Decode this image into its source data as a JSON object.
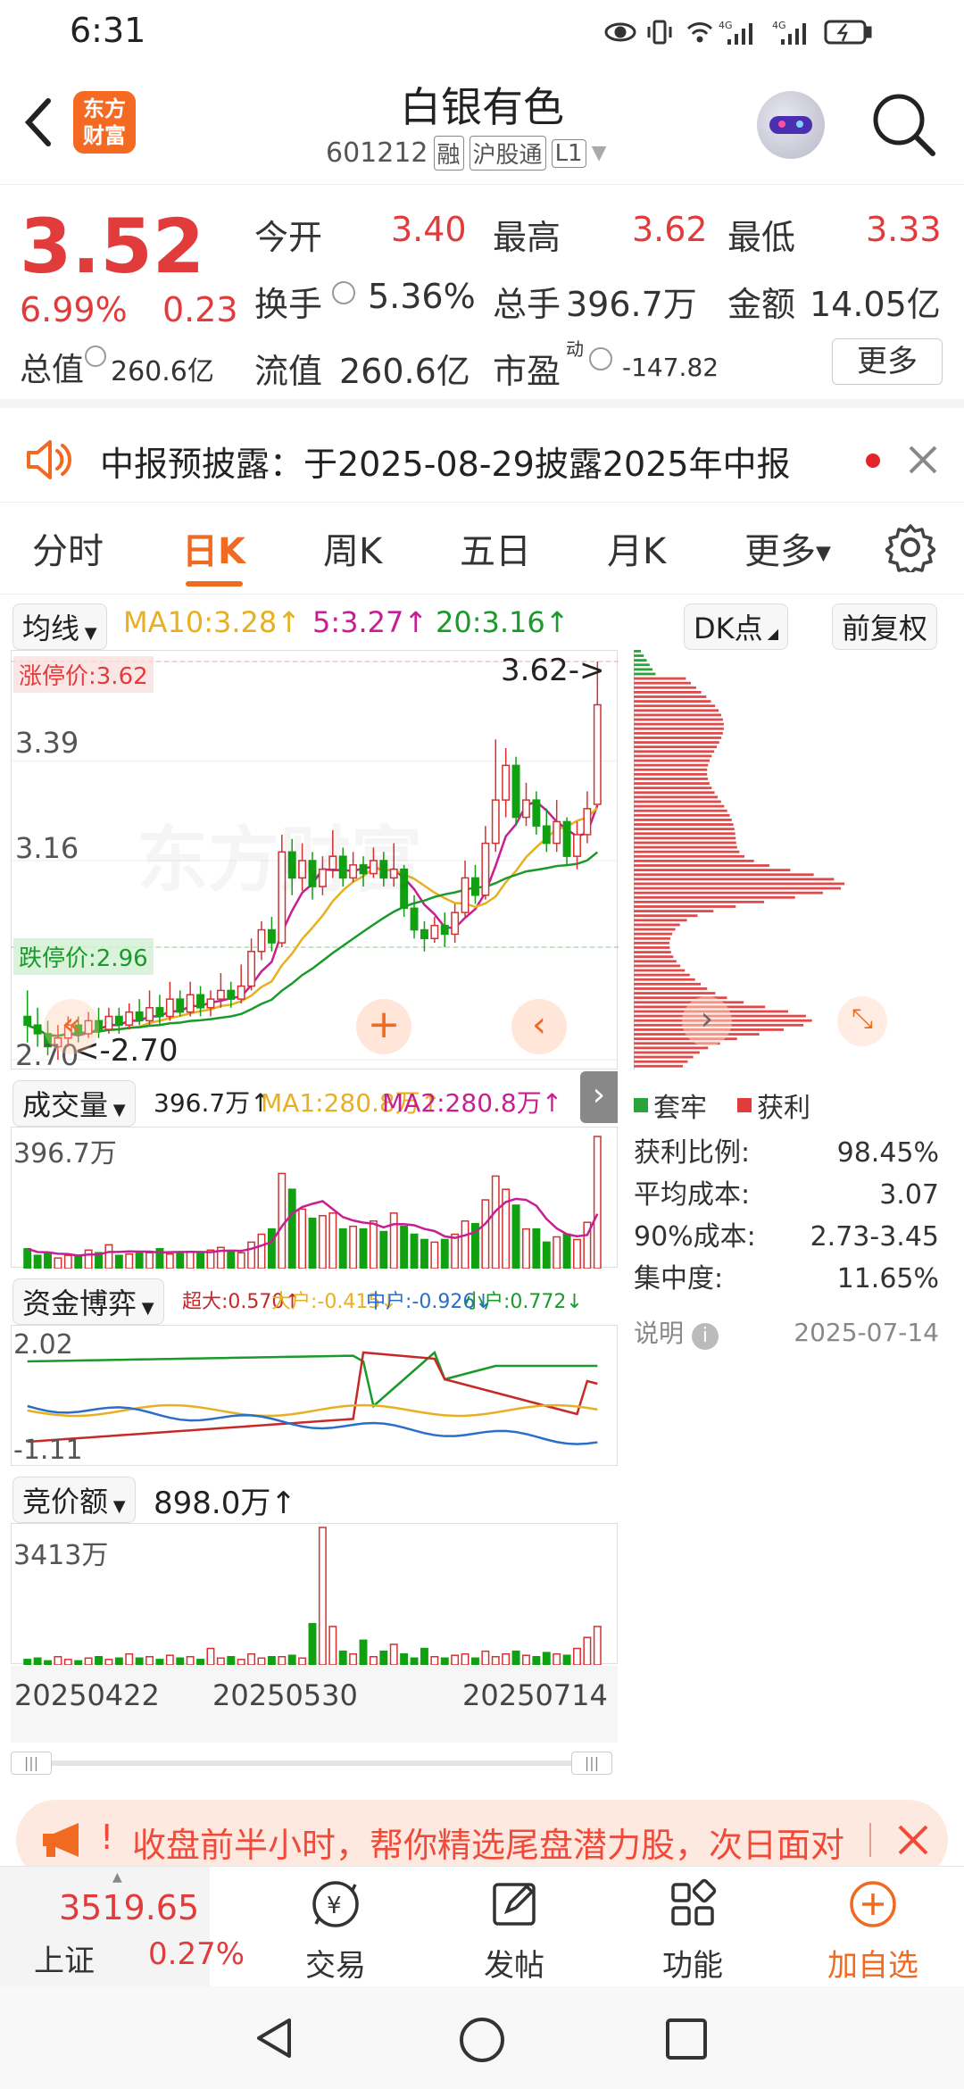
{
  "status": {
    "time": "6:31"
  },
  "header": {
    "title": "白银有色",
    "code": "601212",
    "tags": [
      "融",
      "沪股通",
      "L1"
    ],
    "logo_lines": [
      "东方",
      "财富"
    ]
  },
  "quote": {
    "price": "3.52",
    "change_pct": "6.99%",
    "change": "0.23",
    "rows": [
      [
        {
          "label": "今开",
          "value": "3.40"
        },
        {
          "label": "最高",
          "value": "3.62"
        },
        {
          "label": "最低",
          "value": "3.33"
        }
      ],
      [
        {
          "label": "换手",
          "value": "5.36%"
        },
        {
          "label": "总手",
          "value": "396.7万"
        },
        {
          "label": "金额",
          "value": "14.05亿"
        }
      ]
    ],
    "cap_label": "总值",
    "cap_value": "260.6亿",
    "float_label": "流值",
    "float_value": "260.6亿",
    "pe_label": "市盈",
    "pe_sup": "动",
    "pe_value": "-147.82",
    "more": "更多"
  },
  "notice": {
    "text": "中报预披露：于2025-08-29披露2025年中报"
  },
  "tabs": [
    "分时",
    "日K",
    "周K",
    "五日",
    "月K",
    "更多"
  ],
  "active_tab": "日K",
  "ma_bar": {
    "label": "均线",
    "ma10": "MA10:3.28↑",
    "ma5": "5:3.27↑",
    "ma20": "20:3.16↑",
    "dk": "DK点",
    "fq": "前复权"
  },
  "kline": {
    "limit_up": "涨停价:3.62",
    "limit_down": "跌停价:2.96",
    "y_labels": [
      "3.39",
      "3.16"
    ],
    "bottom_label": "2.70",
    "high_marker": "3.62->",
    "low_marker": "<-2.70",
    "watermark": "东方财富",
    "candles": [
      [
        2.8,
        2.78,
        2.86,
        2.74
      ],
      [
        2.78,
        2.76,
        2.82,
        2.73
      ],
      [
        2.76,
        2.73,
        2.79,
        2.71
      ],
      [
        2.73,
        2.75,
        2.78,
        2.7
      ],
      [
        2.75,
        2.78,
        2.8,
        2.73
      ],
      [
        2.78,
        2.76,
        2.8,
        2.74
      ],
      [
        2.76,
        2.79,
        2.81,
        2.75
      ],
      [
        2.79,
        2.77,
        2.82,
        2.75
      ],
      [
        2.77,
        2.8,
        2.82,
        2.76
      ],
      [
        2.8,
        2.78,
        2.82,
        2.76
      ],
      [
        2.78,
        2.81,
        2.83,
        2.77
      ],
      [
        2.81,
        2.79,
        2.84,
        2.78
      ],
      [
        2.79,
        2.82,
        2.86,
        2.78
      ],
      [
        2.82,
        2.8,
        2.85,
        2.78
      ],
      [
        2.8,
        2.84,
        2.88,
        2.79
      ],
      [
        2.84,
        2.81,
        2.86,
        2.8
      ],
      [
        2.81,
        2.85,
        2.88,
        2.8
      ],
      [
        2.85,
        2.82,
        2.87,
        2.8
      ],
      [
        2.82,
        2.84,
        2.86,
        2.8
      ],
      [
        2.84,
        2.86,
        2.9,
        2.82
      ],
      [
        2.86,
        2.84,
        2.88,
        2.82
      ],
      [
        2.84,
        2.87,
        2.92,
        2.83
      ],
      [
        2.87,
        2.95,
        2.98,
        2.86
      ],
      [
        2.95,
        3.0,
        3.02,
        2.93
      ],
      [
        3.0,
        2.97,
        3.03,
        2.95
      ],
      [
        2.97,
        3.18,
        3.22,
        2.96
      ],
      [
        3.18,
        3.12,
        3.21,
        3.08
      ],
      [
        3.12,
        3.16,
        3.2,
        3.09
      ],
      [
        3.16,
        3.1,
        3.18,
        3.07
      ],
      [
        3.1,
        3.14,
        3.17,
        3.08
      ],
      [
        3.14,
        3.17,
        3.23,
        3.12
      ],
      [
        3.17,
        3.12,
        3.19,
        3.1
      ],
      [
        3.12,
        3.15,
        3.18,
        3.11
      ],
      [
        3.15,
        3.13,
        3.17,
        3.1
      ],
      [
        3.13,
        3.16,
        3.19,
        3.12
      ],
      [
        3.16,
        3.12,
        3.18,
        3.1
      ],
      [
        3.12,
        3.14,
        3.2,
        3.1
      ],
      [
        3.14,
        3.05,
        3.15,
        3.03
      ],
      [
        3.05,
        3.0,
        3.08,
        2.98
      ],
      [
        3.0,
        2.98,
        3.02,
        2.95
      ],
      [
        2.98,
        3.01,
        3.03,
        2.97
      ],
      [
        3.01,
        2.99,
        3.04,
        2.96
      ],
      [
        2.99,
        3.04,
        3.06,
        2.97
      ],
      [
        3.04,
        3.12,
        3.16,
        3.03
      ],
      [
        3.12,
        3.08,
        3.15,
        3.06
      ],
      [
        3.08,
        3.2,
        3.24,
        3.07
      ],
      [
        3.2,
        3.3,
        3.44,
        3.18
      ],
      [
        3.3,
        3.38,
        3.42,
        3.26
      ],
      [
        3.38,
        3.26,
        3.4,
        3.24
      ],
      [
        3.26,
        3.3,
        3.34,
        3.24
      ],
      [
        3.3,
        3.24,
        3.32,
        3.22
      ],
      [
        3.24,
        3.2,
        3.28,
        3.18
      ],
      [
        3.2,
        3.25,
        3.3,
        3.18
      ],
      [
        3.25,
        3.17,
        3.26,
        3.15
      ],
      [
        3.17,
        3.22,
        3.25,
        3.14
      ],
      [
        3.22,
        3.28,
        3.32,
        3.2
      ],
      [
        3.29,
        3.52,
        3.62,
        3.33
      ]
    ]
  },
  "chip": {
    "legend": [
      "套牢",
      "获利"
    ],
    "stats": [
      {
        "label": "获利比例:",
        "value": "98.45%"
      },
      {
        "label": "平均成本:",
        "value": "3.07"
      },
      {
        "label": "90%成本:",
        "value": "2.73-3.45"
      },
      {
        "label": "集中度:",
        "value": "11.65%"
      }
    ],
    "note_label": "说明",
    "note_date": "2025-07-14"
  },
  "volume": {
    "label": "成交量",
    "val": "396.7万↑",
    "ma1": "MA1:280.8万↑",
    "ma2": "MA2:280.8万↑",
    "scale": "396.7万",
    "bars": [
      0.15,
      0.1,
      0.12,
      0.08,
      0.1,
      0.09,
      0.14,
      0.12,
      0.18,
      0.1,
      0.11,
      0.13,
      0.12,
      0.15,
      0.11,
      0.12,
      0.13,
      0.12,
      0.14,
      0.16,
      0.13,
      0.12,
      0.2,
      0.26,
      0.3,
      0.72,
      0.6,
      0.45,
      0.38,
      0.4,
      0.42,
      0.3,
      0.32,
      0.3,
      0.36,
      0.28,
      0.42,
      0.32,
      0.26,
      0.22,
      0.2,
      0.22,
      0.26,
      0.36,
      0.34,
      0.52,
      0.7,
      0.6,
      0.48,
      0.3,
      0.3,
      0.2,
      0.24,
      0.26,
      0.22,
      0.35,
      1.0
    ]
  },
  "capital": {
    "label": "资金博弈",
    "super": "超大:0.570↑",
    "big": "大户:-0.415↓",
    "mid": "中户:-0.926↓",
    "small": "小户:0.772↓",
    "top": "2.02",
    "bottom": "-1.11"
  },
  "auction": {
    "label": "竞价额",
    "val": "898.0万↑",
    "scale": "3413万",
    "bars": [
      0.04,
      0.05,
      0.03,
      0.06,
      0.04,
      0.03,
      0.05,
      0.06,
      0.04,
      0.05,
      0.08,
      0.05,
      0.06,
      0.04,
      0.07,
      0.05,
      0.06,
      0.04,
      0.12,
      0.05,
      0.06,
      0.04,
      0.08,
      0.05,
      0.06,
      0.06,
      0.07,
      0.05,
      0.3,
      1.0,
      0.28,
      0.1,
      0.08,
      0.18,
      0.06,
      0.1,
      0.15,
      0.08,
      0.05,
      0.12,
      0.06,
      0.05,
      0.07,
      0.08,
      0.05,
      0.1,
      0.06,
      0.08,
      0.1,
      0.07,
      0.06,
      0.09,
      0.08,
      0.07,
      0.12,
      0.2,
      0.28
    ]
  },
  "dates": [
    "20250422",
    "20250530",
    "20250714"
  ],
  "banner": {
    "text": "收盘前半小时，帮你精选尾盘潜力股，次日面对"
  },
  "bottom_nav": {
    "index_value": "3519.65",
    "index_name": "上证",
    "index_pct": "0.27%",
    "items": [
      "交易",
      "发帖",
      "功能",
      "加自选"
    ]
  }
}
